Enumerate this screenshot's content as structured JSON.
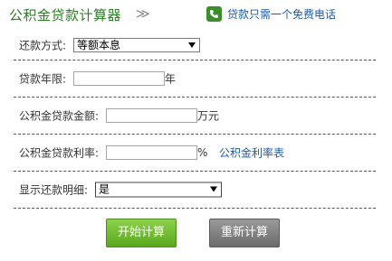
{
  "header": {
    "title": "公积金贷款计算器",
    "title_arrow": "≫",
    "hotline_icon": "phone-icon",
    "hotline_text": "贷款只需一个免费电话"
  },
  "form": {
    "repayment_method": {
      "label": "还款方式:",
      "selected": "等额本息"
    },
    "loan_term": {
      "label": "贷款年限:",
      "value": "",
      "unit": "年"
    },
    "loan_amount": {
      "label": "公积金贷款金额:",
      "value": "",
      "unit": "万元"
    },
    "loan_rate": {
      "label": "公积金贷款利率:",
      "value": "",
      "unit": "%",
      "link": "公积金利率表"
    },
    "show_details": {
      "label": "显示还款明细:",
      "selected": "是"
    }
  },
  "buttons": {
    "start": "开始计算",
    "reset": "重新计算"
  },
  "colors": {
    "title_green": "#2d7d27",
    "link_blue": "#1f5aa6",
    "start_button": "#6fbb2f",
    "reset_button": "#7d7d7d"
  }
}
